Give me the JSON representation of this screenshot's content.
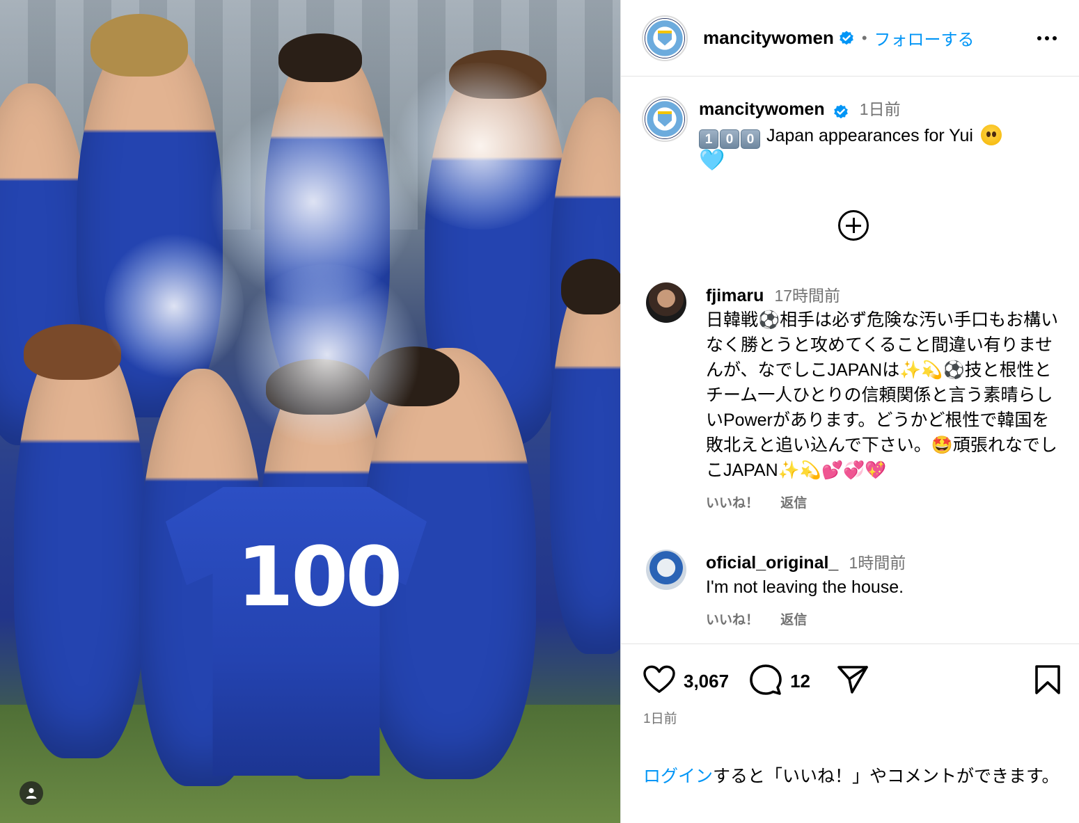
{
  "header": {
    "username": "mancitywomen",
    "separator": "•",
    "follow_label": "フォローする"
  },
  "caption": {
    "username": "mancitywomen",
    "time": "1日前",
    "keycaps": [
      "1",
      "0",
      "0"
    ],
    "text": " Japan appearances for Yui",
    "heart_emoji": "🩵"
  },
  "comments": [
    {
      "username": "fjimaru",
      "time": "17時間前",
      "text": "日韓戦⚽️相手は必ず危険な汚い手口もお構いなく勝とうと攻めてくること間違い有りませんが、なでしこJAPANは✨💫⚽️技と根性とチーム一人ひとりの信頼関係と言う素晴らしいPowerがあります。どうかど根性で韓国を敗北えと追い込んで下さい。🤩頑張れなでしこJAPAN✨💫💕💞💖",
      "like_label": "いいね！",
      "reply_label": "返信"
    },
    {
      "username": "oficial_original_",
      "time": "1時間前",
      "text": "I'm not leaving the house.",
      "like_label": "いいね！",
      "reply_label": "返信"
    }
  ],
  "actions": {
    "likes": "3,067",
    "comments": "12"
  },
  "post_date": "1日前",
  "login_hint": {
    "link": "ログイン",
    "rest": "すると「いいね！」やコメントができます。"
  },
  "photo": {
    "shirt_number": "100"
  },
  "colors": {
    "accent": "#0095f6",
    "muted": "#737373",
    "verified": "#0095f6"
  },
  "icons": [
    "more-icon",
    "verified-icon",
    "add-comments-icon",
    "heart-icon",
    "comment-icon",
    "share-icon",
    "bookmark-icon",
    "user-tag-icon"
  ]
}
